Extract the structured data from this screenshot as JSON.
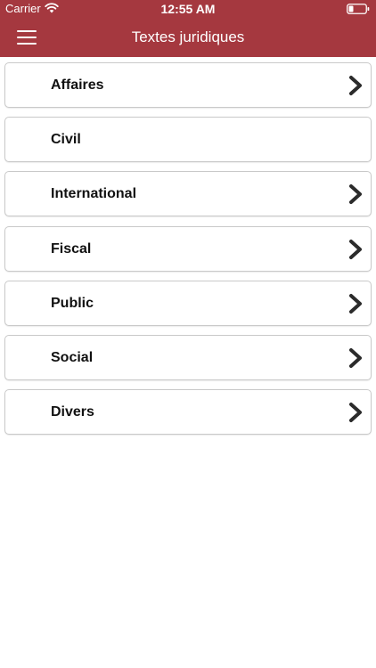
{
  "status_bar": {
    "carrier": "Carrier",
    "time": "12:55 AM",
    "icons": [
      "wifi-icon",
      "battery-icon"
    ]
  },
  "nav": {
    "title": "Textes juridiques",
    "menu_icon": "hamburger-menu-icon"
  },
  "colors": {
    "header_background": "#a5383f",
    "header_text": "#ffffff",
    "item_border": "#c9c9c9",
    "chevron": "#2b2b2b"
  },
  "items": [
    {
      "label": "Affaires",
      "has_chevron": true
    },
    {
      "label": "Civil",
      "has_chevron": false
    },
    {
      "label": "International",
      "has_chevron": true
    },
    {
      "label": "Fiscal",
      "has_chevron": true
    },
    {
      "label": "Public",
      "has_chevron": true
    },
    {
      "label": "Social",
      "has_chevron": true
    },
    {
      "label": "Divers",
      "has_chevron": true
    }
  ]
}
